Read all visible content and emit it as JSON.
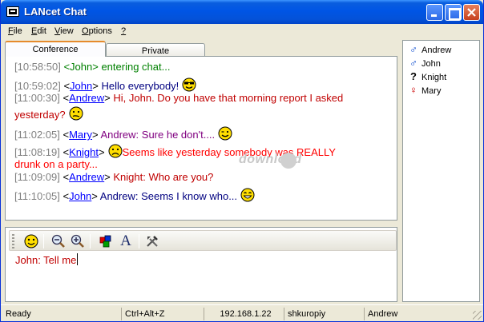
{
  "window": {
    "title": "LANcet Chat"
  },
  "menu": [
    "File",
    "Edit",
    "View",
    "Options",
    "?"
  ],
  "menu_underline": [
    "F",
    "E",
    "V",
    "O",
    "?"
  ],
  "tabs": [
    {
      "label": "Conference",
      "active": true
    },
    {
      "label": "Private",
      "active": false
    }
  ],
  "messages": [
    {
      "time": "[10:58:50]",
      "pre": " <",
      "nick": "John",
      "post": "> entering chat...",
      "kind": "system",
      "smiley": ""
    },
    {
      "time": "[10:59:02]",
      "pre": " <",
      "nick": "John",
      "post": ">",
      "text": " Hello everybody!",
      "color": "blue",
      "smiley": "cool-smiley-icon"
    },
    {
      "time": "[11:00:30]",
      "pre": " <",
      "nick": "Andrew",
      "post": ">",
      "text": " Hi, John. Do you have that morning report I asked",
      "color": "red",
      "smiley": ""
    },
    {
      "cont": "yesterday?",
      "color": "red",
      "smiley": "confused-smiley-icon"
    },
    {
      "time": "[11:02:05]",
      "pre": " <",
      "nick": "Mary",
      "post": ">",
      "text": " Andrew: Sure he don't....",
      "color": "purple",
      "smiley": "wink-smiley-icon"
    },
    {
      "time": "[11:08:19]",
      "pre": " <",
      "nick": "Knight",
      "post": ">",
      "text": "Seems like yesterday somebody was REALLY",
      "color": "brightred",
      "smiley": "sad-smiley-icon",
      "smiley_before": true
    },
    {
      "cont": "drunk on a party...",
      "color": "brightred",
      "smiley": ""
    },
    {
      "time": "[11:09:09]",
      "pre": " <",
      "nick": "Andrew",
      "post": ">",
      "text": " Knight: Who are you?",
      "color": "red",
      "smiley": ""
    },
    {
      "time": "[11:10:05]",
      "pre": " <",
      "nick": "John",
      "post": ">",
      "text": " Andrew: Seems I know who...",
      "color": "blue",
      "smiley": "laugh-smiley-icon"
    }
  ],
  "watermark": "download",
  "input": {
    "value": "John: Tell me"
  },
  "toolbar_icons": [
    "smiley-icon",
    "zoom-out-icon",
    "zoom-in-icon",
    "color-icon",
    "font-icon",
    "settings-icon"
  ],
  "toolbar_font_glyph": "A",
  "users": [
    {
      "name": "Andrew",
      "gender": "male",
      "symbol": "♂"
    },
    {
      "name": "John",
      "gender": "male",
      "symbol": "♂"
    },
    {
      "name": "Knight",
      "gender": "unknown",
      "symbol": "?"
    },
    {
      "name": "Mary",
      "gender": "female",
      "symbol": "♀"
    }
  ],
  "status": {
    "state": "Ready",
    "hotkey": "Ctrl+Alt+Z",
    "ip": "192.168.1.22",
    "host": "shkuropiy",
    "user": "Andrew"
  },
  "colors": {
    "title_bar": "#0055e5",
    "active_tab_accent": "#e68b2c",
    "nick_link": "#0000ff",
    "system_msg": "#008000"
  }
}
